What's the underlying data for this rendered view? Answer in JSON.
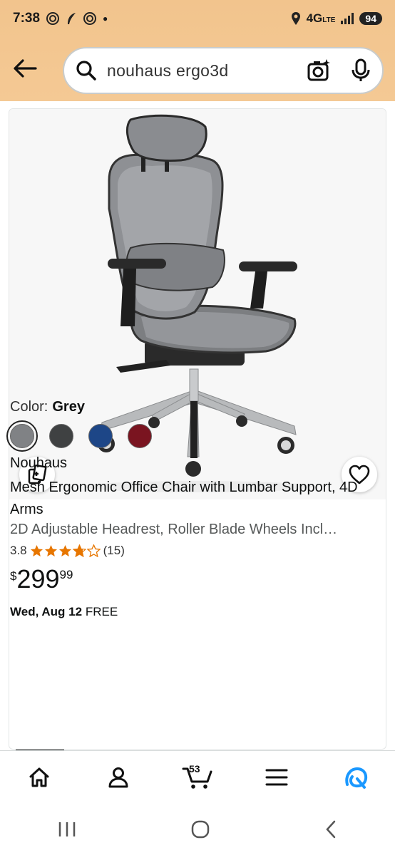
{
  "status": {
    "time": "7:38",
    "network": "4G",
    "network_sub": "LTE",
    "battery": "94"
  },
  "search": {
    "query": "nouhaus ergo3d"
  },
  "product": {
    "color_label": "Color:",
    "color_value": "Grey",
    "swatches": [
      {
        "name": "grey",
        "color": "#808285"
      },
      {
        "name": "dark-grey",
        "color": "#3f4142"
      },
      {
        "name": "navy-blue",
        "color": "#1d4687"
      },
      {
        "name": "burgundy",
        "color": "#7a1420"
      }
    ],
    "brand": "Nouhaus",
    "title": "Mesh Ergonomic Office Chair with Lumbar Support, 4D Arms",
    "subtitle": "2D Adjustable Headrest, Roller Blade Wheels Incl…",
    "rating": "3.8",
    "rating_stars": 3.8,
    "review_count": "(15)",
    "price_symbol": "$",
    "price_whole": "299",
    "price_fraction": "99",
    "delivery_date": "Wed, Aug 12",
    "delivery_note": "FREE"
  },
  "bottom_nav": {
    "cart_count": "53"
  },
  "colors": {
    "header_bg": "#f2c48d",
    "star": "#e77600",
    "alexa": "#1a98ff"
  }
}
